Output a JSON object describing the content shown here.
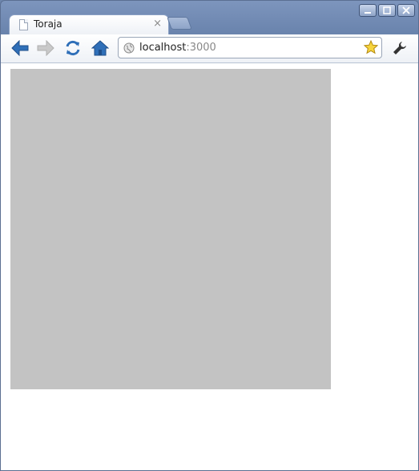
{
  "window": {
    "controls": [
      {
        "name": "minimize-button",
        "icon": "minimize-icon"
      },
      {
        "name": "maximize-button",
        "icon": "maximize-icon"
      },
      {
        "name": "close-window-button",
        "icon": "close-icon"
      }
    ]
  },
  "tab": {
    "title": "Toraja",
    "close_glyph": "×"
  },
  "toolbar": {
    "back_icon": "back-arrow-icon",
    "forward_icon": "forward-arrow-icon",
    "reload_icon": "reload-icon",
    "home_icon": "home-icon",
    "wrench_icon": "wrench-icon"
  },
  "omnibox": {
    "host": "localhost",
    "port": ":3000",
    "star_icon": "bookmark-star-icon"
  },
  "colors": {
    "frame": "#6d86ad",
    "content_box": "#c3c3c3",
    "nav_arrow": "#2f6fb8"
  }
}
